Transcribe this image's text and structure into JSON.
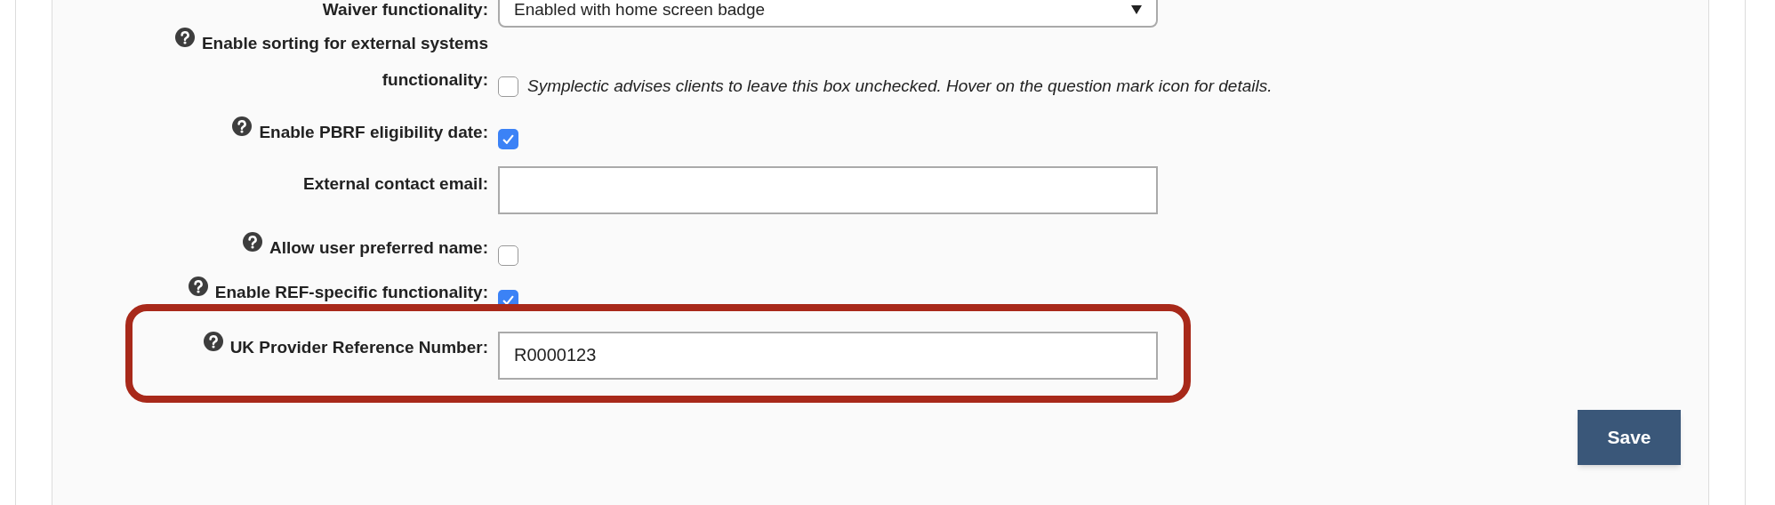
{
  "settings": [
    {
      "kind": "select",
      "label": "Waiver functionality:",
      "help": false,
      "highlighted": false,
      "value": "Enabled with home screen badge"
    },
    {
      "kind": "checkbox",
      "label": "Enable sorting for external systems functionality:",
      "help": true,
      "highlighted": false,
      "checked": false,
      "note": "Symplectic advises clients to leave this box unchecked. Hover on the question mark icon for details."
    },
    {
      "kind": "checkbox",
      "label": "Enable PBRF eligibility date:",
      "help": true,
      "highlighted": false,
      "checked": true
    },
    {
      "kind": "text",
      "label": "External contact email:",
      "help": false,
      "highlighted": false
    },
    {
      "kind": "checkbox",
      "label": "Allow user preferred name:",
      "help": true,
      "highlighted": false,
      "checked": false
    },
    {
      "kind": "checkbox",
      "label": "Enable REF-specific functionality:",
      "help": true,
      "highlighted": false,
      "checked": true
    },
    {
      "kind": "text",
      "label": "UK Provider Reference Number:",
      "help": true,
      "highlighted": true,
      "value": "R0000123"
    }
  ],
  "save_button": "Save"
}
